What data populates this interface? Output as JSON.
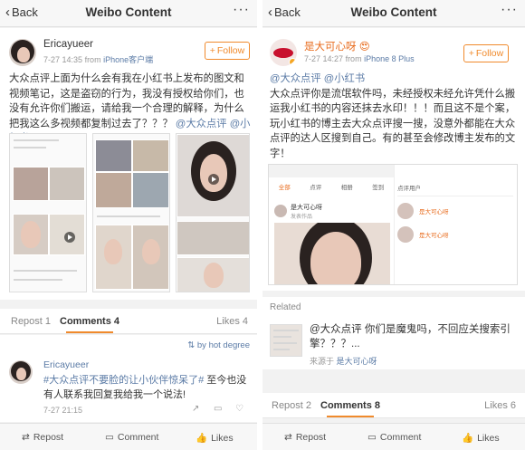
{
  "left": {
    "nav": {
      "back_label": "Back",
      "title": "Weibo Content",
      "more": "···"
    },
    "post": {
      "username": "Ericayueer",
      "time": "7-27 14:35",
      "from_prefix": "from",
      "source": "iPhone客户端",
      "follow_label": "Follow",
      "text_before": "大众点评上面为什么会有我在小红书上发布的图文和视频笔记，这是盗窃的行为，我没有授权给你们，也没有允许你们搬运，请给我一个合理的解释，为什么把我这么多视频都复制过去了？？？",
      "link1": "@大众点评",
      "link2": "@小红书"
    },
    "tabs": {
      "repost": "Repost 1",
      "comments": "Comments 4",
      "likes": "Likes 4"
    },
    "sort_label": "by hot degree",
    "comment": {
      "username": "Ericayueer",
      "hashtag": "#大众点评不要脸的让小伙伴惊呆了#",
      "text": "至今也没有人联系我回复我给我一个说法!",
      "time": "7-27 21:15"
    },
    "bottom": {
      "repost": "Repost",
      "comment": "Comment",
      "likes": "Likes"
    }
  },
  "right": {
    "nav": {
      "back_label": "Back",
      "title": "Weibo Content",
      "more": "···"
    },
    "post": {
      "username": "是大可心呀",
      "emoji": "😍",
      "time": "7-27 14:27",
      "from_prefix": "from",
      "source": "iPhone 8 Plus",
      "follow_label": "Follow",
      "link1": "@大众点评",
      "link2": "@小红书",
      "text": "大众点评你是流氓软件吗，未经授权未经允许凭什么搬运我小红书的内容还抹去水印！！！而且这不是个案，玩小红书的博主去大众点评搜一搜，没意外都能在大众点评的达人区搜到自己。有的甚至会修改博主发布的文字！"
    },
    "screenshot": {
      "tabs": [
        "全部",
        "点评",
        "相册",
        "签到"
      ],
      "sidebar_title": "点评用户",
      "user1": "是大可心呀",
      "user2": "是大可心呀",
      "row_name": "是大可心呀",
      "row_sub": "发表作品"
    },
    "related": {
      "label": "Related",
      "text": "@大众点评 你们是魔鬼吗，不回应关搜索引擎？？？...",
      "source_prefix": "来源于",
      "source_name": "是大可心呀"
    },
    "tabs": {
      "repost": "Repost 2",
      "comments": "Comments 8",
      "likes": "Likes 6"
    },
    "bottom": {
      "repost": "Repost",
      "comment": "Comment",
      "likes": "Likes"
    }
  },
  "colors": {
    "accent": "#f08a2c",
    "link": "#5b7ba6",
    "name_orange": "#e86b1c"
  }
}
